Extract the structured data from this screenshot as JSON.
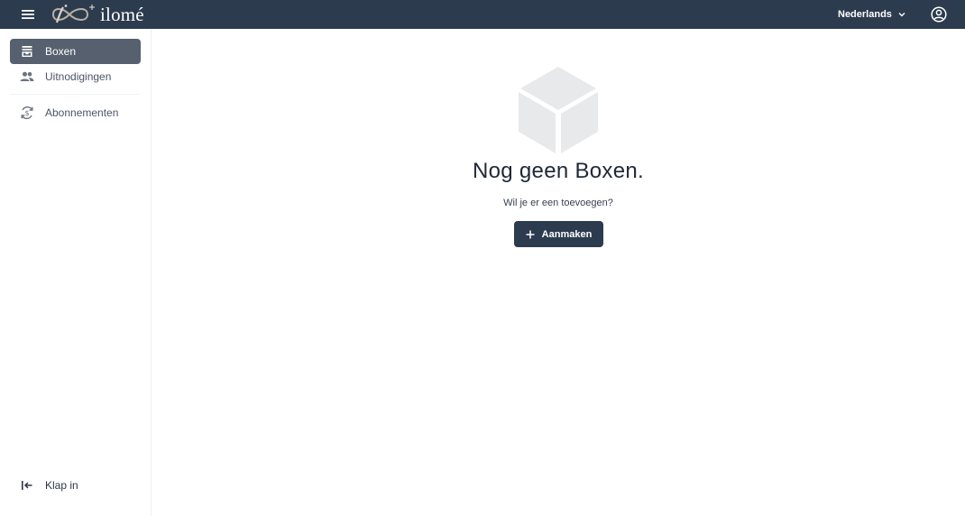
{
  "topbar": {
    "menu_icon": "menu-icon",
    "logo_text": "ilomé",
    "language": "Nederlands",
    "account_icon": "account-circle-icon",
    "background": "#2c3b4e"
  },
  "sidebar": {
    "items": [
      {
        "label": "Boxen",
        "icon": "inbox-box-icon",
        "active": true
      },
      {
        "label": "Uitnodigingen",
        "icon": "people-icon",
        "active": false
      },
      {
        "label": "Abonnementen",
        "icon": "subscription-icon",
        "active": false
      }
    ],
    "collapse_label": "Klap in",
    "collapse_icon": "collapse-left-icon",
    "active_color": "#56606e"
  },
  "empty_state": {
    "illustration": "box-cube-icon",
    "title": "Nog geen Boxen.",
    "subtitle": "Wil je er een toevoegen?",
    "button_label": "Aanmaken",
    "button_icon": "plus-icon"
  }
}
